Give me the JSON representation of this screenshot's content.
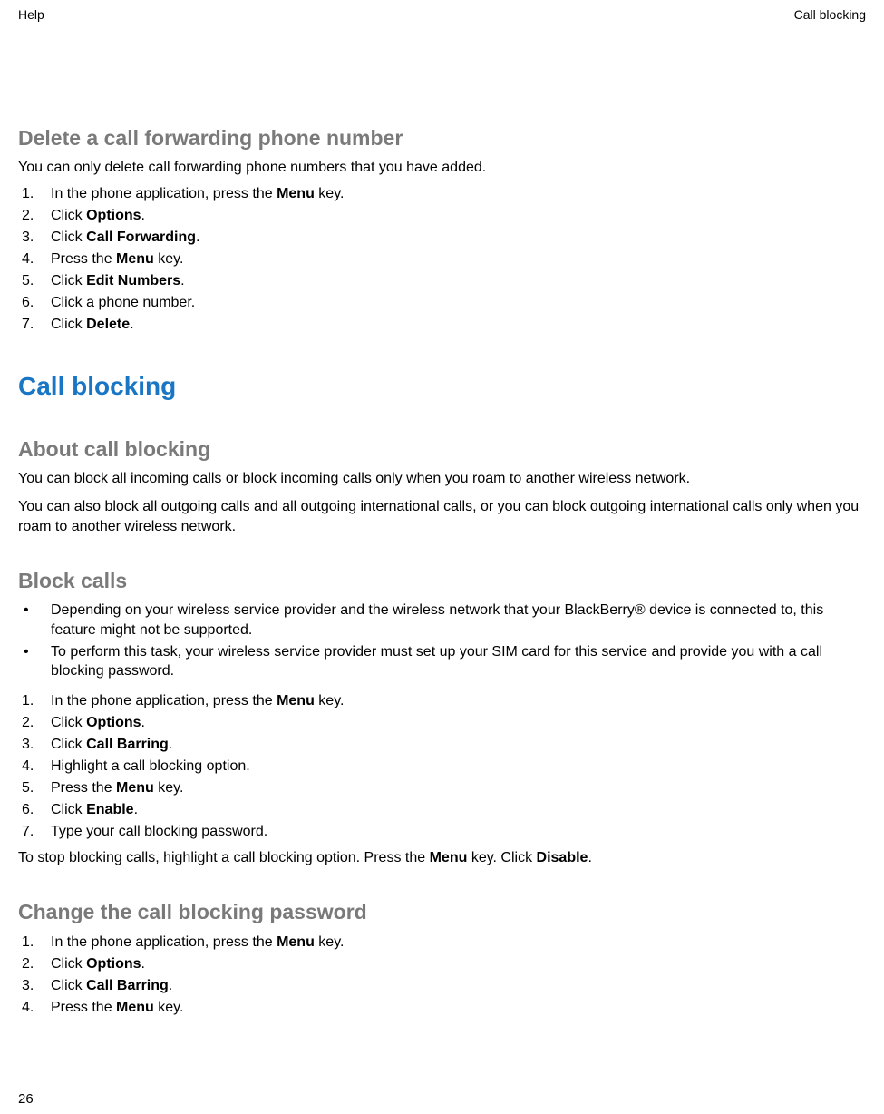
{
  "header": {
    "left": "Help",
    "right": "Call blocking"
  },
  "footer": {
    "page": "26"
  },
  "sec1": {
    "title": "Delete a call forwarding phone number",
    "intro": "You can only delete call forwarding phone numbers that you have added.",
    "steps": [
      {
        "pre": "In the phone application, press the ",
        "b": "Menu",
        "post": " key."
      },
      {
        "pre": "Click ",
        "b": "Options",
        "post": "."
      },
      {
        "pre": "Click ",
        "b": "Call Forwarding",
        "post": "."
      },
      {
        "pre": "Press the ",
        "b": "Menu",
        "post": " key."
      },
      {
        "pre": "Click ",
        "b": "Edit Numbers",
        "post": "."
      },
      {
        "pre": "Click a phone number.",
        "b": "",
        "post": ""
      },
      {
        "pre": "Click ",
        "b": "Delete",
        "post": "."
      }
    ]
  },
  "sec2": {
    "title": "Call blocking"
  },
  "sec3": {
    "title": "About call blocking",
    "p1": "You can block all incoming calls or block incoming calls only when you roam to another wireless network.",
    "p2": "You can also block all outgoing calls and all outgoing international calls, or you can block outgoing international calls only when you roam to another wireless network."
  },
  "sec4": {
    "title": "Block calls",
    "notes": [
      "Depending on your wireless service provider and the wireless network that your BlackBerry® device is connected to, this feature might not be supported.",
      "To perform this task, your wireless service provider must set up your SIM card for this service and provide you with a call blocking password."
    ],
    "steps": [
      {
        "pre": "In the phone application, press the ",
        "b": "Menu",
        "post": " key."
      },
      {
        "pre": "Click ",
        "b": "Options",
        "post": "."
      },
      {
        "pre": "Click ",
        "b": "Call Barring",
        "post": "."
      },
      {
        "pre": "Highlight a call blocking option.",
        "b": "",
        "post": ""
      },
      {
        "pre": "Press the ",
        "b": "Menu",
        "post": " key."
      },
      {
        "pre": "Click ",
        "b": "Enable",
        "post": "."
      },
      {
        "pre": "Type your call blocking password.",
        "b": "",
        "post": ""
      }
    ],
    "closing": {
      "t1": "To stop blocking calls, highlight a call blocking option. Press the ",
      "b1": "Menu",
      "t2": " key. Click ",
      "b2": "Disable",
      "t3": "."
    }
  },
  "sec5": {
    "title": "Change the call blocking password",
    "steps": [
      {
        "pre": "In the phone application, press the ",
        "b": "Menu",
        "post": " key."
      },
      {
        "pre": "Click ",
        "b": "Options",
        "post": "."
      },
      {
        "pre": "Click ",
        "b": "Call Barring",
        "post": "."
      },
      {
        "pre": "Press the ",
        "b": "Menu",
        "post": " key."
      }
    ]
  }
}
